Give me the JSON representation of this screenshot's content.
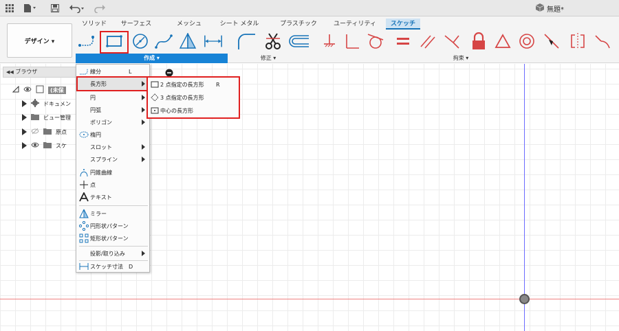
{
  "appbar": {
    "doc_title": "無題*"
  },
  "tabs": [
    {
      "label": "ソリッド",
      "active": false
    },
    {
      "label": "サーフェス",
      "active": false
    },
    {
      "label": "メッシュ",
      "active": false
    },
    {
      "label": "シート メタル",
      "active": false
    },
    {
      "label": "プラスチック",
      "active": false
    },
    {
      "label": "ユーティリティ",
      "active": false
    },
    {
      "label": "スケッチ",
      "active": true
    }
  ],
  "workspace_button": {
    "label": "デザイン ▾"
  },
  "ribbon_groups": {
    "create": "作成 ▾",
    "modify": "修正 ▾",
    "constraints": "拘束 ▾"
  },
  "browser": {
    "title": "ブラウザ",
    "items": [
      {
        "label": "(未保"
      },
      {
        "label": "ドキュメン"
      },
      {
        "label": "ビュー管理"
      },
      {
        "label": "原点"
      },
      {
        "label": "スケ"
      }
    ]
  },
  "create_menu": {
    "items": [
      {
        "label": "線分",
        "key": "L",
        "submenu": false
      },
      {
        "label": "長方形",
        "key": "",
        "submenu": true
      },
      {
        "label": "円",
        "key": "",
        "submenu": true
      },
      {
        "label": "円弧",
        "key": "",
        "submenu": true
      },
      {
        "label": "ポリゴン",
        "key": "",
        "submenu": true
      },
      {
        "label": "楕円",
        "key": "",
        "submenu": false
      },
      {
        "label": "スロット",
        "key": "",
        "submenu": true
      },
      {
        "label": "スプライン",
        "key": "",
        "submenu": true
      },
      {
        "label": "円錐曲線",
        "key": "",
        "submenu": false
      },
      {
        "label": "点",
        "key": "",
        "submenu": false
      },
      {
        "label": "テキスト",
        "key": "",
        "submenu": false
      },
      {
        "label": "ミラー",
        "key": "",
        "submenu": false
      },
      {
        "label": "円形状パターン",
        "key": "",
        "submenu": false
      },
      {
        "label": "矩形状パターン",
        "key": "",
        "submenu": false
      },
      {
        "label": "投影/取り込み",
        "key": "",
        "submenu": true
      },
      {
        "label": "スケッチ寸法",
        "key": "D",
        "submenu": false
      }
    ]
  },
  "rectangle_submenu": {
    "items": [
      {
        "label": "2 点指定の長方形",
        "key": "R"
      },
      {
        "label": "3 点指定の長方形",
        "key": ""
      },
      {
        "label": "中心の長方形",
        "key": ""
      }
    ]
  },
  "colors": {
    "accent": "#1783d6",
    "highlight": "#e02020",
    "constraint": "#d64545"
  }
}
